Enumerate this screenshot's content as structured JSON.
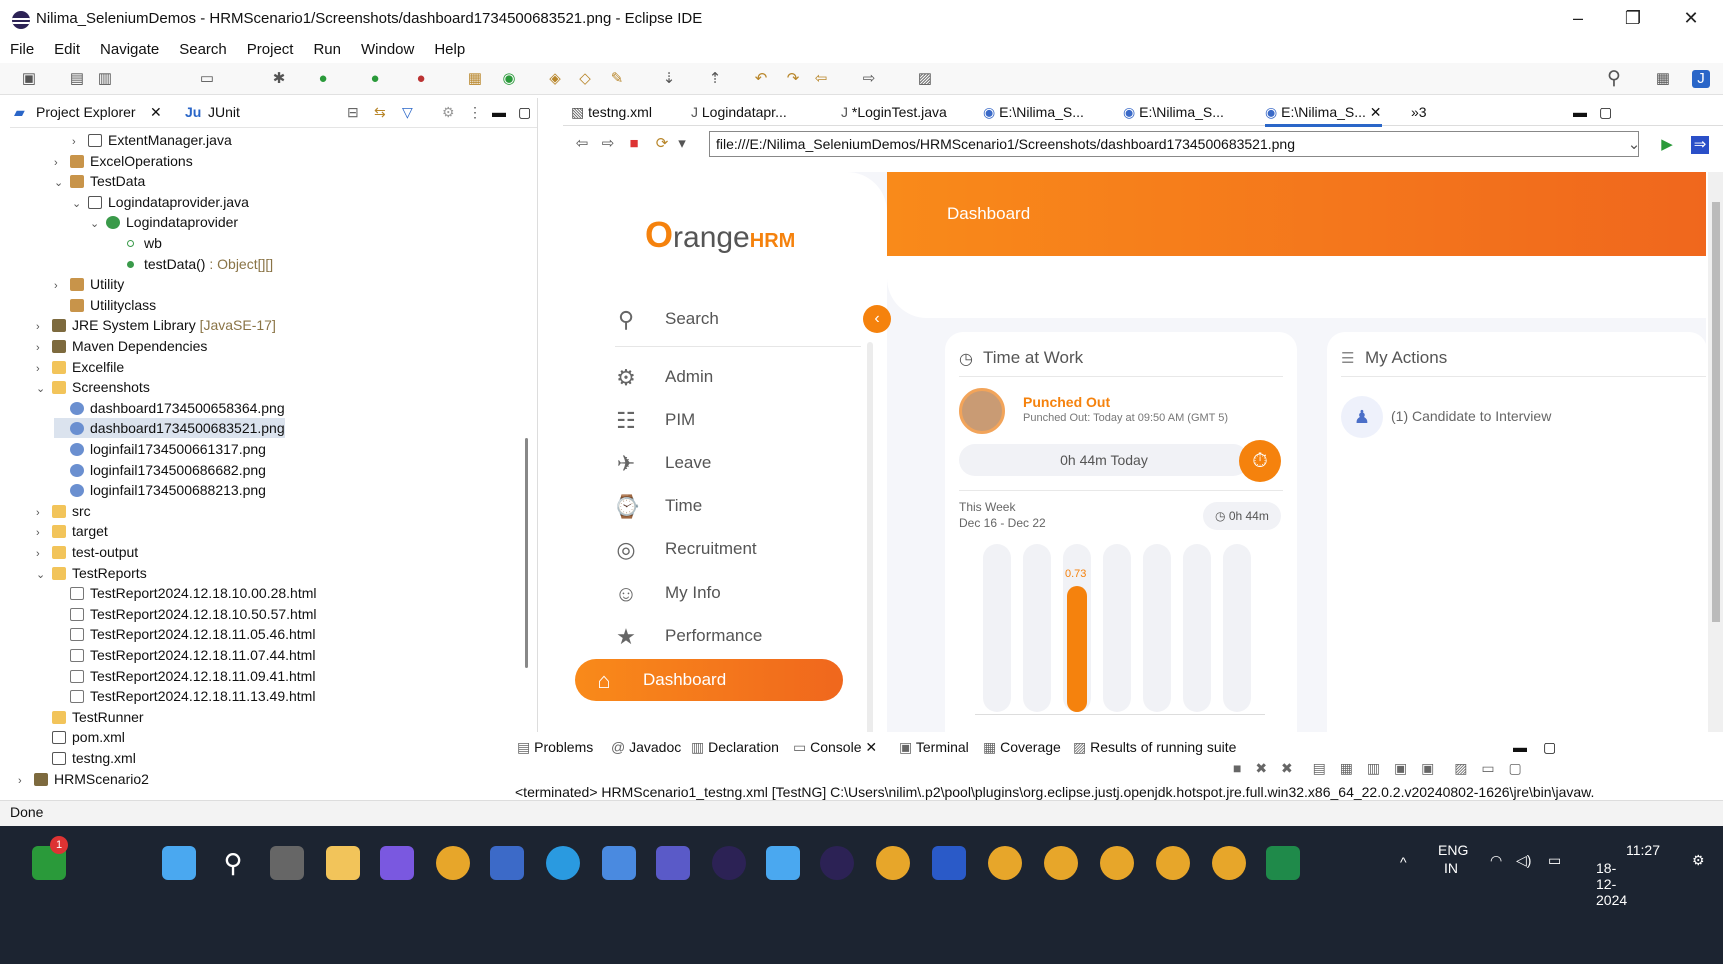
{
  "window": {
    "title": "Nilima_SeleniumDemos - HRMScenario1/Screenshots/dashboard1734500683521.png - Eclipse IDE"
  },
  "menu": [
    "File",
    "Edit",
    "Navigate",
    "Search",
    "Project",
    "Run",
    "Window",
    "Help"
  ],
  "left_panel": {
    "tabs": [
      "Project Explorer",
      "JUnit"
    ],
    "tree": [
      {
        "label": "ExtentManager.java",
        "icon": "java",
        "indent": 3,
        "twisty": ">"
      },
      {
        "label": "ExcelOperations",
        "icon": "pkg",
        "indent": 2,
        "twisty": ">"
      },
      {
        "label": "TestData",
        "icon": "pkg",
        "indent": 2,
        "twisty": "v"
      },
      {
        "label": "Logindataprovider.java",
        "icon": "java",
        "indent": 3,
        "twisty": "v"
      },
      {
        "label": "Logindataprovider",
        "icon": "cls",
        "indent": 4,
        "twisty": "v"
      },
      {
        "label": "wb",
        "icon": "doto",
        "indent": 5,
        "twisty": ""
      },
      {
        "label": "testData()",
        "suffix": " : Object[][]",
        "icon": "dotg",
        "indent": 5,
        "twisty": ""
      },
      {
        "label": "Utility",
        "icon": "pkg",
        "indent": 2,
        "twisty": ">"
      },
      {
        "label": "Utilityclass",
        "icon": "pkg",
        "indent": 2,
        "twisty": ""
      },
      {
        "label": "JRE System Library",
        "suffix": " [JavaSE-17]",
        "icon": "lib",
        "indent": 1,
        "twisty": ">"
      },
      {
        "label": "Maven Dependencies",
        "icon": "lib",
        "indent": 1,
        "twisty": ">"
      },
      {
        "label": "Excelfile",
        "icon": "folder",
        "indent": 1,
        "twisty": ">"
      },
      {
        "label": "Screenshots",
        "icon": "folder",
        "indent": 1,
        "twisty": "v"
      },
      {
        "label": "dashboard1734500658364.png",
        "icon": "png",
        "indent": 2,
        "twisty": ""
      },
      {
        "label": "dashboard1734500683521.png",
        "icon": "png",
        "indent": 2,
        "twisty": "",
        "selected": true
      },
      {
        "label": "loginfail1734500661317.png",
        "icon": "png",
        "indent": 2,
        "twisty": ""
      },
      {
        "label": "loginfail1734500686682.png",
        "icon": "png",
        "indent": 2,
        "twisty": ""
      },
      {
        "label": "loginfail1734500688213.png",
        "icon": "png",
        "indent": 2,
        "twisty": ""
      },
      {
        "label": "src",
        "icon": "folder",
        "indent": 1,
        "twisty": ">"
      },
      {
        "label": "target",
        "icon": "folder",
        "indent": 1,
        "twisty": ">"
      },
      {
        "label": "test-output",
        "icon": "folder",
        "indent": 1,
        "twisty": ">"
      },
      {
        "label": "TestReports",
        "icon": "folder",
        "indent": 1,
        "twisty": "v"
      },
      {
        "label": "TestReport2024.12.18.10.00.28.html",
        "icon": "html",
        "indent": 2,
        "twisty": ""
      },
      {
        "label": "TestReport2024.12.18.10.50.57.html",
        "icon": "html",
        "indent": 2,
        "twisty": ""
      },
      {
        "label": "TestReport2024.12.18.11.05.46.html",
        "icon": "html",
        "indent": 2,
        "twisty": ""
      },
      {
        "label": "TestReport2024.12.18.11.07.44.html",
        "icon": "html",
        "indent": 2,
        "twisty": ""
      },
      {
        "label": "TestReport2024.12.18.11.09.41.html",
        "icon": "html",
        "indent": 2,
        "twisty": ""
      },
      {
        "label": "TestReport2024.12.18.11.13.49.html",
        "icon": "html",
        "indent": 2,
        "twisty": ""
      },
      {
        "label": "TestRunner",
        "icon": "folder",
        "indent": 1,
        "twisty": ""
      },
      {
        "label": "pom.xml",
        "icon": "xml",
        "indent": 1,
        "twisty": ""
      },
      {
        "label": "testng.xml",
        "icon": "xml",
        "indent": 1,
        "twisty": ""
      },
      {
        "label": "HRMScenario2",
        "icon": "lib",
        "indent": 0,
        "twisty": ">"
      }
    ]
  },
  "editor": {
    "tabs": [
      "testng.xml",
      "Logindatapr...",
      "*LoginTest.java",
      "E:\\Nilima_S...",
      "E:\\Nilima_S...",
      "E:\\Nilima_S..."
    ],
    "overflow": "»3",
    "url": "file:///E:/Nilima_SeleniumDemos/HRMScenario1/Screenshots/dashboard1734500683521.png"
  },
  "orangehrm": {
    "logo_o": "O",
    "logo_text": "range",
    "logo_hrm": "HRM",
    "header_title": "Dashboard",
    "nav": [
      {
        "label": "Search",
        "icon": "search-icon",
        "glyph": "⚲"
      },
      {
        "label": "Admin",
        "icon": "admin-icon",
        "glyph": "⚙"
      },
      {
        "label": "PIM",
        "icon": "pim-icon",
        "glyph": "☷"
      },
      {
        "label": "Leave",
        "icon": "leave-icon",
        "glyph": "✈"
      },
      {
        "label": "Time",
        "icon": "time-icon",
        "glyph": "⌚"
      },
      {
        "label": "Recruitment",
        "icon": "recruitment-icon",
        "glyph": "◎"
      },
      {
        "label": "My Info",
        "icon": "myinfo-icon",
        "glyph": "☺"
      },
      {
        "label": "Performance",
        "icon": "performance-icon",
        "glyph": "★"
      },
      {
        "label": "Dashboard",
        "icon": "home-icon",
        "glyph": "⌂",
        "active": true
      }
    ],
    "time_at_work": {
      "title": "Time at Work",
      "status": "Punched Out",
      "detail": "Punched Out: Today at 09:50 AM (GMT 5)",
      "today": "0h 44m Today",
      "week_label": "This Week",
      "week_range": "Dec 16 - Dec 22",
      "week_total": "0h 44m",
      "bar_value_label": "0.73",
      "bar_fraction": [
        0,
        0,
        0.75,
        0,
        0,
        0,
        0
      ]
    },
    "my_actions": {
      "title": "My Actions",
      "item": "(1) Candidate to Interview"
    }
  },
  "bottom_panel": {
    "tabs": [
      "Problems",
      "Javadoc",
      "Declaration",
      "Console",
      "Terminal",
      "Coverage",
      "Results of running suite"
    ],
    "console_line": "<terminated> HRMScenario1_testng.xml [TestNG] C:\\Users\\nilim\\.p2\\pool\\plugins\\org.eclipse.justj.openjdk.hotspot.jre.full.win32.x86_64_22.0.2.v20240802-1626\\jre\\bin\\javaw."
  },
  "status": "Done",
  "tray": {
    "lang": "ENG",
    "region": "IN",
    "time": "11:27",
    "date": "18-12-2024",
    "notif": "1"
  },
  "colors": {
    "accent": "#f5820d",
    "eclipse_sel": "#dbe3ee"
  }
}
